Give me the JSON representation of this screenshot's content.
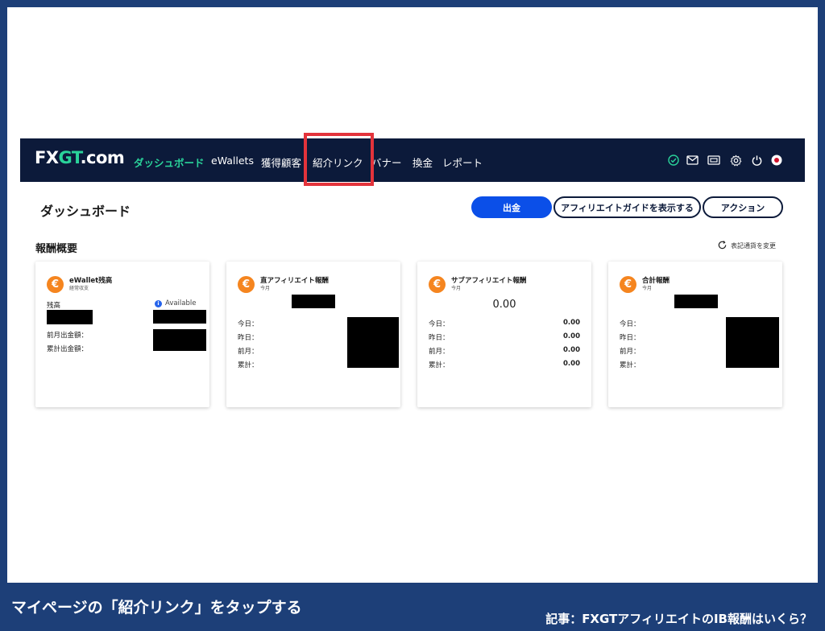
{
  "brand": {
    "logo_text_a": "FX",
    "logo_text_b": "GT",
    "logo_text_c": ".com"
  },
  "nav": {
    "items": [
      {
        "label": "ダッシュボード"
      },
      {
        "label": "eWallets"
      },
      {
        "label": "獲得顧客"
      },
      {
        "label": "紹介リンク"
      },
      {
        "label": "バナー"
      },
      {
        "label": "換金"
      },
      {
        "label": "レポート"
      }
    ],
    "icons": [
      "check-circle",
      "mail",
      "wallet",
      "gear",
      "power",
      "japan-flag"
    ]
  },
  "page": {
    "title": "ダッシュボード"
  },
  "actions": {
    "withdraw": "出金",
    "guide": "アフィリエイトガイドを表示する",
    "action": "アクション"
  },
  "summary": {
    "title": "報酬概要",
    "currency_toggle": "表記通貨を変更"
  },
  "cards": {
    "ewallet": {
      "title": "eWallet残高",
      "subtitle": "経常収支",
      "balance_label": "残高",
      "available_label": "Available",
      "last_month_label": "前月出金額：",
      "total_label": "累計出金額："
    },
    "direct": {
      "title": "直アフィリエイト報酬",
      "subtitle": "今月",
      "rows": [
        "今日：",
        "昨日：",
        "前月：",
        "累計："
      ]
    },
    "sub": {
      "title": "サブアフィリエイト報酬",
      "subtitle": "今月",
      "amount": "0.00",
      "rows": [
        {
          "label": "今日：",
          "value": "0.00"
        },
        {
          "label": "昨日：",
          "value": "0.00"
        },
        {
          "label": "前月：",
          "value": "0.00"
        },
        {
          "label": "累計：",
          "value": "0.00"
        }
      ]
    },
    "total": {
      "title": "合計報酬",
      "subtitle": "今月",
      "rows": [
        "今日：",
        "昨日：",
        "前月：",
        "累計："
      ]
    }
  },
  "caption": {
    "left": "マイページの「紹介リンク」をタップする",
    "right": "記事：FXGTアフィリエイトのIB報酬はいくら？"
  },
  "colors": {
    "frame": "#1d3f78",
    "navbar": "#0c1a3a",
    "brand_green": "#2ad39a",
    "primary_button": "#0b4fe8",
    "highlight": "#e3333b",
    "card_icon": "#f5851f"
  }
}
